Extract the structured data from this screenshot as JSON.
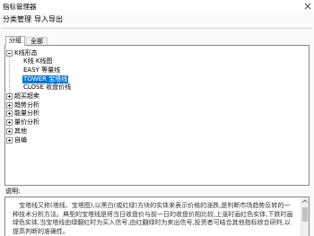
{
  "window": {
    "title": "指标管理器",
    "close_icon": "close-icon"
  },
  "menu": [
    {
      "label": "分类管理"
    },
    {
      "label": "导入导出"
    }
  ],
  "tabs": [
    {
      "label": "分组",
      "selected": true
    },
    {
      "label": "全部",
      "selected": false
    }
  ],
  "tree": [
    {
      "label": "K线形态",
      "expanded": true,
      "icon": "collapse-box-icon",
      "children": [
        {
          "label": "K线 K线图",
          "selected": false
        },
        {
          "label": "EASY 等量线",
          "selected": false
        },
        {
          "label": "TOWER 宝塔线",
          "selected": true
        },
        {
          "label": "CLOSE 收盘价线",
          "selected": false
        }
      ]
    },
    {
      "label": "超买超卖",
      "expanded": false,
      "icon": "expand-box-icon"
    },
    {
      "label": "趋势分析",
      "expanded": false,
      "icon": "expand-box-icon"
    },
    {
      "label": "能量分析",
      "expanded": false,
      "icon": "expand-box-icon"
    },
    {
      "label": "量价分析",
      "expanded": false,
      "icon": "expand-box-icon"
    },
    {
      "label": "其他",
      "expanded": false,
      "icon": "expand-box-icon"
    },
    {
      "label": "自编",
      "expanded": false,
      "icon": "expand-box-icon"
    }
  ],
  "description": {
    "label": "说明:",
    "text": "宝塔线又称(塔线、宝塔图),以黑白(或红绿)方块的实体来表示价格的涨跌,是判断市场趋势反转的一种技术分析方法。典型的宝塔线是将当日收盘价与前一日的收盘价相比较,上涨时画红色实体,下跌时画绿色实体,当宝塔线由绿翻红时为买入信号,由红翻绿时为卖出信号,投资者可结合其他指标综合研判,以提高判断的准确性。"
  },
  "colors": {
    "selection_bg": "#0078d7",
    "selection_text": "#ffffff",
    "panel_border": "#828790"
  }
}
